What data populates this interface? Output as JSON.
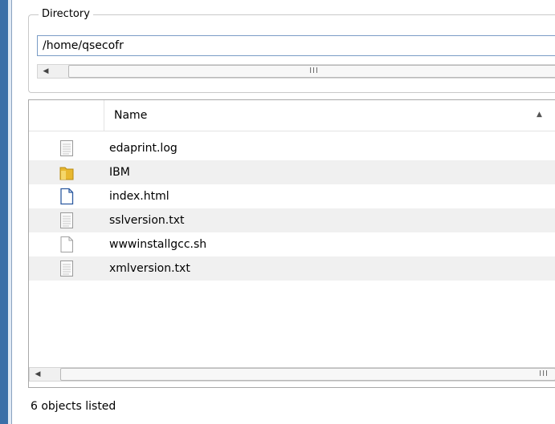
{
  "directory": {
    "legend": "Directory",
    "path": "/home/qsecofr"
  },
  "list": {
    "column_name": "Name",
    "files": [
      {
        "name": "edaprint.log",
        "icon": "text-file-icon"
      },
      {
        "name": "IBM",
        "icon": "folder-icon"
      },
      {
        "name": "index.html",
        "icon": "html-file-icon"
      },
      {
        "name": "sslversion.txt",
        "icon": "text-file-icon"
      },
      {
        "name": "wwwinstallgcc.sh",
        "icon": "blank-file-icon"
      },
      {
        "name": "xmlversion.txt",
        "icon": "text-file-icon"
      }
    ]
  },
  "status": {
    "text": "6 objects listed"
  },
  "colors": {
    "frame": "#3a6fa8",
    "input_border": "#7a9cc6",
    "alt_row": "#f0f0f0",
    "folder": "#e8b830"
  }
}
